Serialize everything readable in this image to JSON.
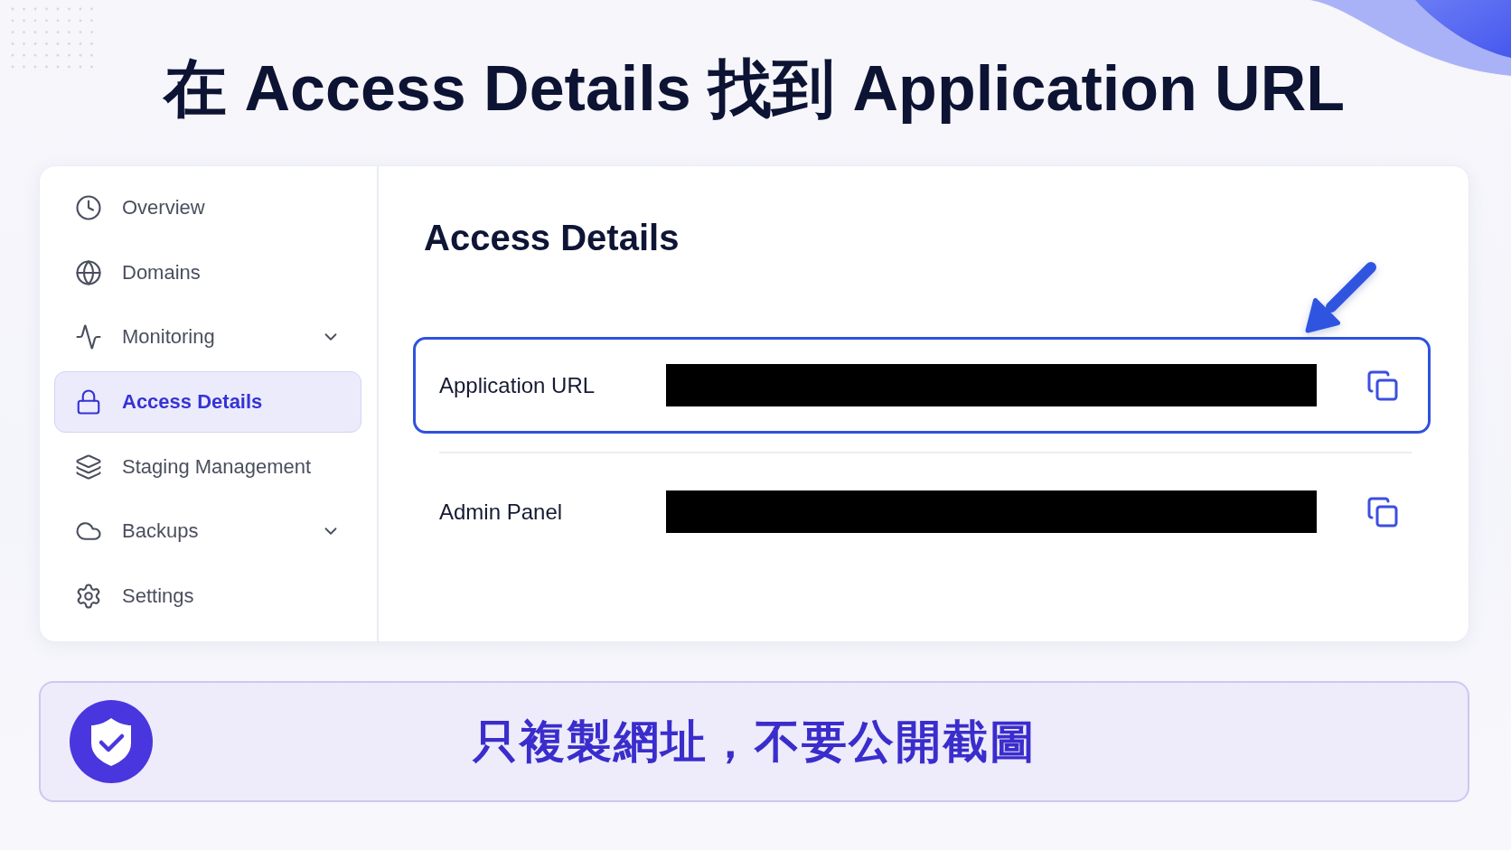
{
  "title": "在 Access Details 找到 Application URL",
  "sidebar": {
    "items": [
      {
        "label": "Overview",
        "selected": false,
        "expandable": false
      },
      {
        "label": "Domains",
        "selected": false,
        "expandable": false
      },
      {
        "label": "Monitoring",
        "selected": false,
        "expandable": true
      },
      {
        "label": "Access Details",
        "selected": true,
        "expandable": false
      },
      {
        "label": "Staging Management",
        "selected": false,
        "expandable": false
      },
      {
        "label": "Backups",
        "selected": false,
        "expandable": true
      },
      {
        "label": "Settings",
        "selected": false,
        "expandable": false
      }
    ]
  },
  "panel": {
    "heading": "Access Details",
    "fields": [
      {
        "label": "Application URL",
        "highlighted": true
      },
      {
        "label": "Admin Panel",
        "highlighted": false
      }
    ]
  },
  "notice": {
    "text": "只複製網址，不要公開截圖"
  }
}
